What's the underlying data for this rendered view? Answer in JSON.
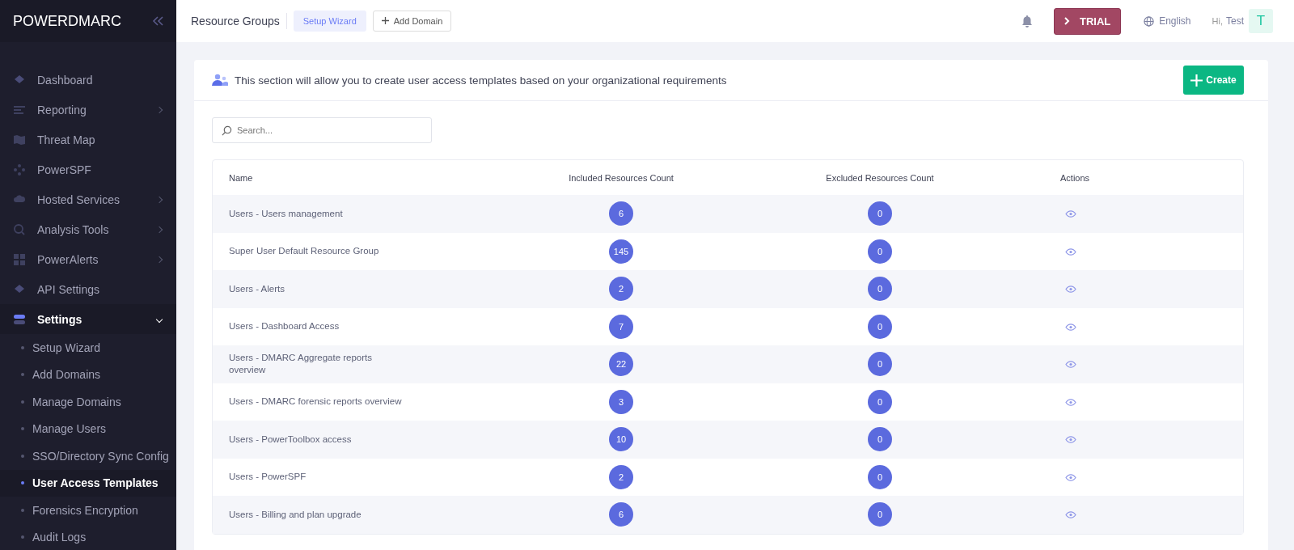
{
  "sidebar": {
    "logo": "POWERDMARC",
    "items": [
      {
        "label": "Dashboard"
      },
      {
        "label": "Reporting",
        "expanded": false
      },
      {
        "label": "Threat Map"
      },
      {
        "label": "PowerSPF"
      },
      {
        "label": "Hosted Services",
        "expanded": false
      },
      {
        "label": "Analysis Tools",
        "expanded": false
      },
      {
        "label": "PowerAlerts",
        "expanded": false
      },
      {
        "label": "API Settings"
      },
      {
        "label": "Settings",
        "expanded": true,
        "children": [
          {
            "label": "Setup Wizard",
            "selected": false
          },
          {
            "label": "Add Domains",
            "selected": false
          },
          {
            "label": "Manage Domains",
            "selected": false
          },
          {
            "label": "Manage Users",
            "selected": false
          },
          {
            "label": "SSO/Directory Sync Config",
            "selected": false
          },
          {
            "label": "User Access Templates",
            "selected": true
          },
          {
            "label": "Forensics Encryption",
            "selected": false
          },
          {
            "label": "Audit Logs",
            "selected": false
          }
        ]
      }
    ]
  },
  "topbar": {
    "title": "Resource Groups",
    "setup_button": "Setup Wizard",
    "add_domain_button": "Add Domain",
    "trial_button": "TRIAL",
    "language": "English",
    "greeting": "Hi,",
    "user": "Test",
    "avatar": "T"
  },
  "card": {
    "description": "This section will allow you to create user access templates based on your organizational requirements",
    "create_button": "Create",
    "search": {
      "placeholder": "Search..."
    },
    "table": {
      "columns": [
        "Name",
        "Included Resources Count",
        "Excluded Resources Count",
        "Actions"
      ],
      "rows": [
        {
          "name": "Users - Users management",
          "included": "6",
          "excluded": "0"
        },
        {
          "name": "Super User Default Resource Group",
          "included": "145",
          "excluded": "0"
        },
        {
          "name": "Users - Alerts",
          "included": "2",
          "excluded": "0"
        },
        {
          "name": "Users - Dashboard Access",
          "included": "7",
          "excluded": "0"
        },
        {
          "name": "Users - DMARC Aggregate reports overview",
          "included": "22",
          "excluded": "0"
        },
        {
          "name": "Users - DMARC forensic reports overview",
          "included": "3",
          "excluded": "0"
        },
        {
          "name": "Users - PowerToolbox access",
          "included": "10",
          "excluded": "0"
        },
        {
          "name": "Users - PowerSPF",
          "included": "2",
          "excluded": "0"
        },
        {
          "name": "Users - Billing and plan upgrade",
          "included": "6",
          "excluded": "0"
        }
      ]
    }
  }
}
